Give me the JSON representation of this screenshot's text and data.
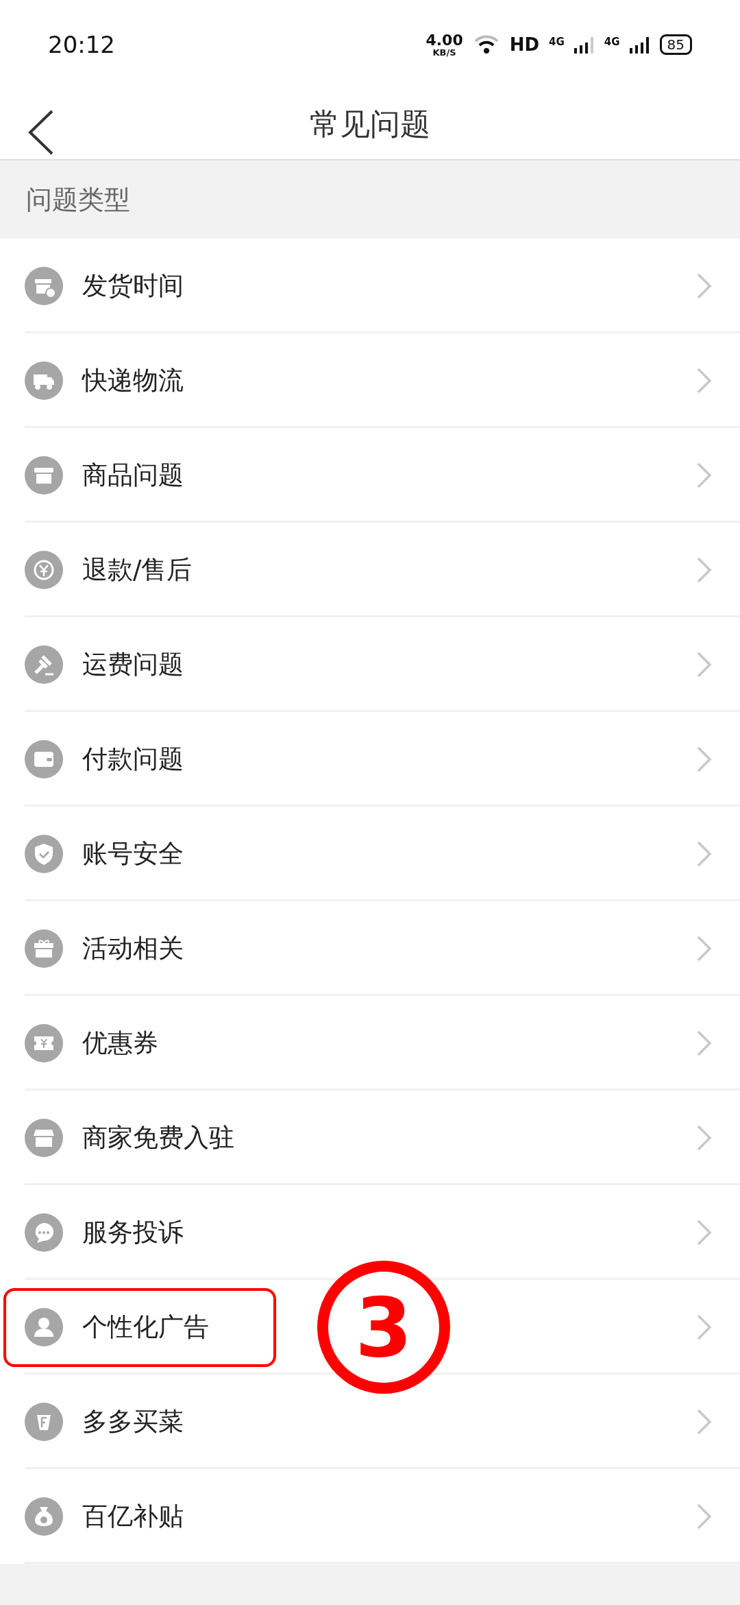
{
  "status_bar": {
    "time": "20:12",
    "speed": "4.00",
    "speed_unit": "KB/S",
    "hd": "HD",
    "network_1": "4G",
    "network_2": "4G",
    "battery": "85"
  },
  "header": {
    "title": "常见问题"
  },
  "section": {
    "title": "问题类型"
  },
  "items": [
    {
      "label": "发货时间",
      "highlighted": false
    },
    {
      "label": "快递物流",
      "highlighted": false
    },
    {
      "label": "商品问题",
      "highlighted": false
    },
    {
      "label": "退款/售后",
      "highlighted": false
    },
    {
      "label": "运费问题",
      "highlighted": false
    },
    {
      "label": "付款问题",
      "highlighted": false
    },
    {
      "label": "账号安全",
      "highlighted": false
    },
    {
      "label": "活动相关",
      "highlighted": false
    },
    {
      "label": "优惠券",
      "highlighted": false
    },
    {
      "label": "商家免费入驻",
      "highlighted": false
    },
    {
      "label": "服务投诉",
      "highlighted": false
    },
    {
      "label": "个性化广告",
      "highlighted": true,
      "annotation": "3"
    },
    {
      "label": "多多买菜",
      "highlighted": false
    },
    {
      "label": "百亿补贴",
      "highlighted": false
    }
  ]
}
